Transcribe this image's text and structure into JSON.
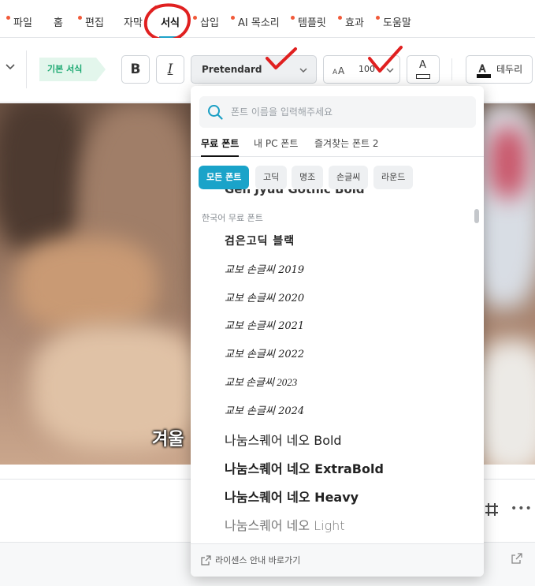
{
  "menubar": {
    "items": [
      {
        "label": "파일",
        "dot": true
      },
      {
        "label": "홈",
        "dot": false
      },
      {
        "label": "편집",
        "dot": true
      },
      {
        "label": "자막",
        "dot": false
      },
      {
        "label": "서식",
        "dot": false,
        "active": true
      },
      {
        "label": "삽입",
        "dot": true
      },
      {
        "label": "AI 목소리",
        "dot": true
      },
      {
        "label": "템플릿",
        "dot": true
      },
      {
        "label": "효과",
        "dot": true
      },
      {
        "label": "도움말",
        "dot": true
      }
    ]
  },
  "toolbar": {
    "style_tag": "기본 서식",
    "bold_icon": "B",
    "italic_icon": "I",
    "font_value": "Pretendard",
    "size_value": "100",
    "color_icon": "A",
    "border_label": "테두리"
  },
  "preview": {
    "caption": "겨울"
  },
  "font_panel": {
    "search_placeholder": "폰트 이름을 입력해주세요",
    "tabs": [
      "무료 폰트",
      "내 PC 폰트",
      "즐겨찾는 폰트 2"
    ],
    "chips": [
      "모든 폰트",
      "고딕",
      "명조",
      "손글씨",
      "라운드"
    ],
    "partial_item": "Gen Jyuu Gothic Bold",
    "section_header": "한국어 무료 폰트",
    "fonts": [
      "검은고딕 블랙",
      "교보 손글씨 2019",
      "교보 손글씨 2020",
      "교보 손글씨 2021",
      "교보 손글씨 2022",
      "교보 손글씨 2023",
      "교보 손글씨 2024",
      "나눔스퀘어 네오 Bold",
      "나눔스퀘어 네오 ExtraBold",
      "나눔스퀘어 네오 Heavy",
      "나눔스퀘어 네오 Light"
    ],
    "footer_link": "라이센스 안내 바로가기"
  },
  "colors": {
    "accent": "#1aa3c9",
    "menu_dot": "#f15a3a",
    "style_tag": "#1aa870",
    "annotation": "#e02020"
  },
  "icons": {
    "search": "search-icon",
    "chevron": "chevron-down-icon",
    "text_size": "text-size-icon",
    "grid": "grid-icon",
    "more": "more-icon",
    "external": "external-link-icon"
  }
}
